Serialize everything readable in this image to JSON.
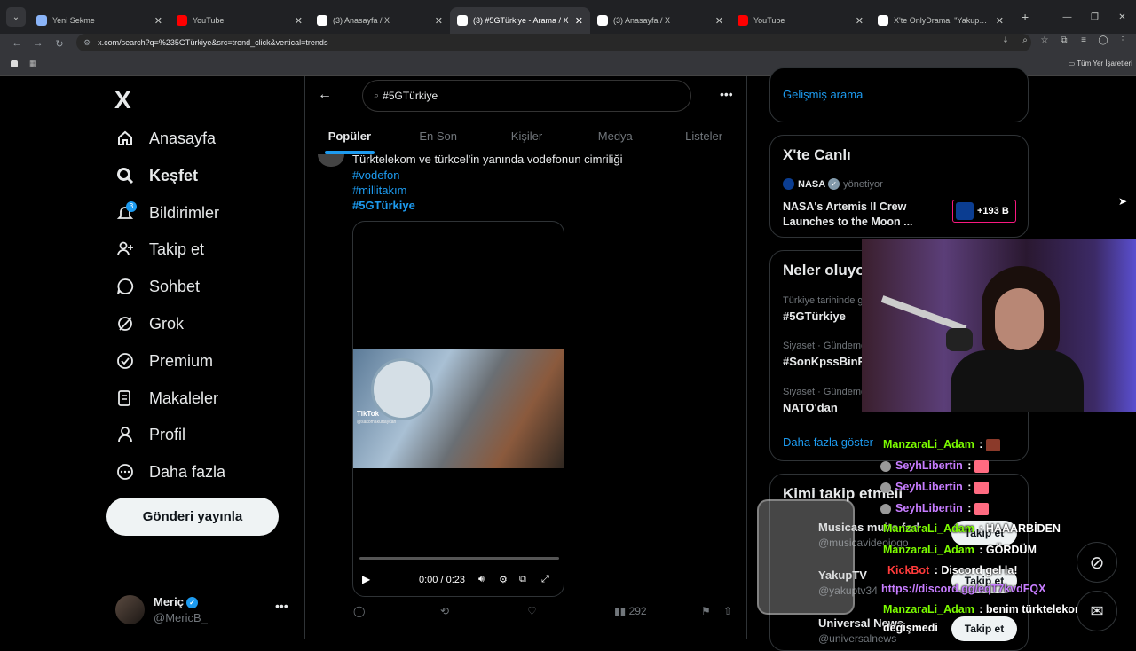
{
  "browser": {
    "tabs": [
      {
        "title": "Yeni Sekme",
        "fav_color": "#8ab4f8"
      },
      {
        "title": "YouTube",
        "fav_color": "#ff0000"
      },
      {
        "title": "(3) Anasayfa / X",
        "fav_color": "#ffffff"
      },
      {
        "title": "(3) #5GTürkiye - Arama / X",
        "fav_color": "#ffffff"
      },
      {
        "title": "(3) Anasayfa / X",
        "fav_color": "#ffffff"
      },
      {
        "title": "YouTube",
        "fav_color": "#ff0000"
      },
      {
        "title": "X'te OnlyDrama: \"YakupTV, ken",
        "fav_color": "#ffffff"
      }
    ],
    "active_tab": 3,
    "url": "x.com/search?q=%235GTürkiye&src=trend_click&vertical=trends",
    "bookmarks_label": "Tüm Yer İşaretleri"
  },
  "sidebar": {
    "logo": "X",
    "items": [
      {
        "label": "Anasayfa",
        "icon": "home-icon",
        "bold": false
      },
      {
        "label": "Keşfet",
        "icon": "search-icon",
        "bold": true
      },
      {
        "label": "Bildirimler",
        "icon": "bell-icon",
        "bold": false,
        "badge": "3"
      },
      {
        "label": "Takip et",
        "icon": "follow-icon",
        "bold": false
      },
      {
        "label": "Sohbet",
        "icon": "chat-icon",
        "bold": false
      },
      {
        "label": "Grok",
        "icon": "grok-icon",
        "bold": false
      },
      {
        "label": "Premium",
        "icon": "premium-icon",
        "bold": false
      },
      {
        "label": "Makaleler",
        "icon": "articles-icon",
        "bold": false
      },
      {
        "label": "Profil",
        "icon": "profile-icon",
        "bold": false
      },
      {
        "label": "Daha fazla",
        "icon": "more-icon",
        "bold": false
      }
    ],
    "post_button": "Gönderi yayınla",
    "account": {
      "name": "Meriç",
      "handle": "@MericB_"
    }
  },
  "search": {
    "query": "#5GTürkiye",
    "tabs": [
      "Popüler",
      "En Son",
      "Kişiler",
      "Medya",
      "Listeler"
    ],
    "active_tab": 0
  },
  "tweet": {
    "text": "Türktelekom ve türkcel'in yanında vodefonun cimriliği",
    "hashtags": [
      "#vodefon",
      "#millitakım",
      "#5GTürkiye"
    ],
    "video": {
      "watermark": "TikTok",
      "watermark_user": "@sakomakurtaycan",
      "time": "0:00 / 0:23",
      "progress": 0
    },
    "views": "292"
  },
  "right": {
    "advanced_search": "Gelişmiş arama",
    "live": {
      "title": "X'te Canlı",
      "host": "NASA",
      "host_role": "yönetiyor",
      "stream_title": "NASA's Artemis II Crew Launches to the Moon ...",
      "listeners": "+193 B"
    },
    "trends": {
      "title": "Neler oluyo",
      "items": [
        {
          "category": "Türkiye tarihinde g",
          "name": "#5GTürkiye"
        },
        {
          "category": "Siyaset · Gündemd",
          "name": "#SonKpssBinR"
        },
        {
          "category": "Siyaset · Gündemd",
          "name": "NATO'dan"
        }
      ],
      "show_more": "Daha fazla göster"
    },
    "who_to_follow": {
      "title": "Kimi takip etmeli",
      "items": [
        {
          "name": "Musicas muito fod",
          "handle": "@musicavideojogo",
          "button": "Takip et"
        },
        {
          "name": "YakupTV",
          "handle": "@yakuptv34",
          "button": "Takip et"
        },
        {
          "name": "Universal News",
          "handle": "@universalnews",
          "button": "Takip et"
        }
      ]
    }
  },
  "stream_chat": [
    {
      "user": "ManzaraLi_Adam",
      "color": "#7cfc00",
      "text": " : ",
      "emote": "#8b3a2a"
    },
    {
      "user": "SeyhLibertin",
      "color": "#c77dff",
      "text": " : ",
      "emote": "#ff6b81"
    },
    {
      "user": "SeyhLibertin",
      "color": "#c77dff",
      "text": " : ",
      "emote": "#ff6b81"
    },
    {
      "user": "SeyhLibertin",
      "color": "#c77dff",
      "text": " : ",
      "emote": "#ff6b81"
    },
    {
      "user": "ManzaraLi_Adam",
      "color": "#7cfc00",
      "text": " : HAAARBİDEN",
      "emote": ""
    },
    {
      "user": "ManzaraLi_Adam",
      "color": "#7cfc00",
      "text": " : GÖRDÜM",
      "emote": ""
    },
    {
      "user": "KickBot",
      "color": "#ff3b3b",
      "text": " : Discord gel la!",
      "emote": ""
    },
    {
      "user": "",
      "color": "#c77dff",
      "text": "https://discord.gg/eqT7kvdFQX",
      "emote": ""
    },
    {
      "user": "ManzaraLi_Adam",
      "color": "#7cfc00",
      "text": " : benim türktelekom bişi",
      "emote": ""
    },
    {
      "user": "",
      "color": "#ffffff",
      "text": "değişmedi",
      "emote": ""
    }
  ],
  "colors": {
    "accent": "#1d9bf0",
    "background": "#000000",
    "text": "#e7e9ea",
    "muted": "#71767b"
  }
}
